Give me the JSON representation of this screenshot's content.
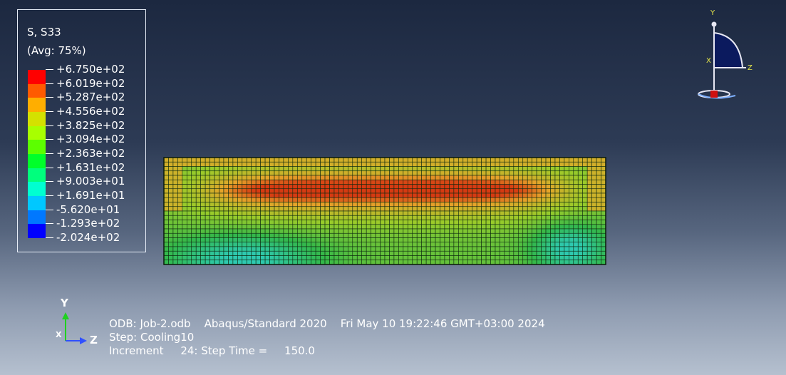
{
  "legend": {
    "title": "S, S33",
    "subtitle": "(Avg: 75%)",
    "values": [
      "+6.750e+02",
      "+6.019e+02",
      "+5.287e+02",
      "+4.556e+02",
      "+3.825e+02",
      "+3.094e+02",
      "+2.363e+02",
      "+1.631e+02",
      "+9.003e+01",
      "+1.691e+01",
      "-5.620e+01",
      "-1.293e+02",
      "-2.024e+02"
    ],
    "colors": [
      "#ff0000",
      "#ff5a00",
      "#ffae00",
      "#d4e100",
      "#a8ff00",
      "#5cff00",
      "#00ff2a",
      "#00ff7d",
      "#00ffd1",
      "#00c8ff",
      "#0078ff",
      "#0000ff"
    ]
  },
  "info": {
    "line1": "ODB: Job-2.odb    Abaqus/Standard 2020    Fri May 10 19:22:46 GMT+03:00 2024",
    "line2": "Step: Cooling10",
    "line3": "Increment     24: Step Time =     150.0"
  },
  "axis_labels": {
    "y": "Y",
    "x": "X",
    "z": "Z"
  },
  "triad_labels": {
    "y": "Y",
    "x": "X",
    "z": "Z"
  },
  "mesh_colors": {
    "hot": "#d63a12",
    "warm": "#e6a42a",
    "mid": "#9acb2a",
    "green": "#33b84a",
    "cool": "#2ec9b0",
    "line": "#0e2a10"
  }
}
